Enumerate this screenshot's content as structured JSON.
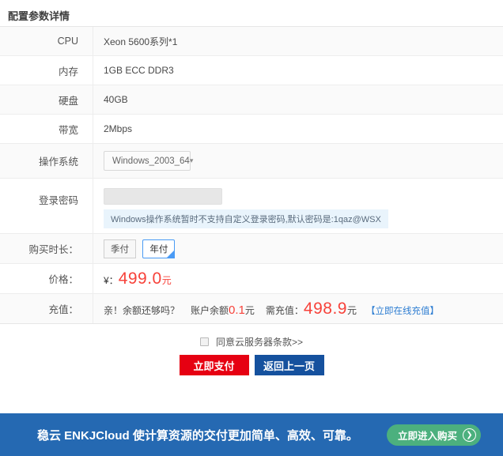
{
  "page": {
    "title": "配置参数详情"
  },
  "table": {
    "rows": [
      {
        "label": "CPU",
        "value": "Xeon 5600系列*1"
      },
      {
        "label": "内存",
        "value": "1GB ECC DDR3"
      },
      {
        "label": "硬盘",
        "value": "40GB"
      },
      {
        "label": "带宽",
        "value": "2Mbps"
      }
    ],
    "os": {
      "label": "操作系统",
      "selected": "Windows_2003_64",
      "caret": "▾"
    },
    "password": {
      "label": "登录密码",
      "value": "",
      "note": "Windows操作系统暂时不支持自定义登录密码,默认密码是:1qaz@WSX"
    },
    "duration": {
      "label": "购买时长：",
      "options": [
        {
          "label": "季付",
          "selected": false
        },
        {
          "label": "年付",
          "selected": true
        }
      ]
    },
    "price": {
      "label": "价格：",
      "currency": "¥：",
      "amount": "499.0",
      "unit": "元"
    },
    "recharge": {
      "label": "充值：",
      "question": "亲！余额还够吗？",
      "balance_label": "账户余额",
      "balance": "0.1",
      "balance_unit": "元",
      "need_label": "需充值：",
      "need": "498.9",
      "need_unit": "元",
      "link": "【立即在线充值】"
    }
  },
  "agreement": {
    "label": "同意云服务器条款>>"
  },
  "actions": {
    "pay": "立即支付",
    "back": "返回上一页"
  },
  "banner": {
    "slogan": "稳云 ENKJCloud 使计算资源的交付更加简单、高效、可靠。",
    "cta": "立即进入购买",
    "arrow": "❯"
  },
  "colors": {
    "pay_button": "#e60012",
    "back_button": "#15519e",
    "banner_bg": "#2569b2",
    "cta_green": "#4cb07e",
    "price_red": "#f7423a",
    "link_blue": "#2d7dd2",
    "selected_border_blue": "#4a9bf5",
    "row_alt_bg": "#fafafa",
    "note_bg": "#e9f4fc"
  }
}
